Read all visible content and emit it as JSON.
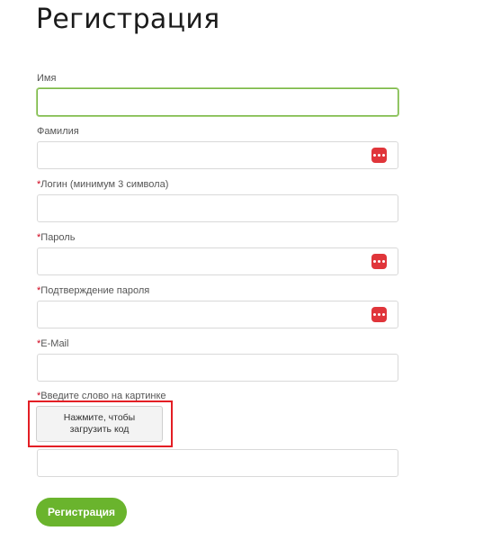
{
  "page": {
    "title": "Регистрация"
  },
  "form": {
    "fields": [
      {
        "label": "Имя",
        "required": "",
        "value": "",
        "placeholder": ""
      },
      {
        "label": "Фамилия",
        "required": "",
        "value": "",
        "placeholder": "",
        "icon": "password-manager-icon"
      },
      {
        "label": "Логин (минимум 3 символа)",
        "required": "*",
        "value": "",
        "placeholder": ""
      },
      {
        "label": "Пароль",
        "required": "*",
        "value": "",
        "placeholder": "",
        "icon": "password-manager-icon"
      },
      {
        "label": "Подтверждение пароля",
        "required": "*",
        "value": "",
        "placeholder": "",
        "icon": "password-manager-icon"
      },
      {
        "label": "E-Mail",
        "required": "*",
        "value": "",
        "placeholder": ""
      }
    ],
    "captcha": {
      "label": "Введите слово на картинке",
      "required": "*",
      "load_button": "Нажмите, чтобы загрузить код",
      "value": "",
      "placeholder": ""
    },
    "submit_label": "Регистрация"
  },
  "colors": {
    "accent": "#6ab42d",
    "focus_border": "#7ab648",
    "required_mark": "#d0021b",
    "highlight": "#e31e24",
    "icon_bg": "#e0353a"
  }
}
